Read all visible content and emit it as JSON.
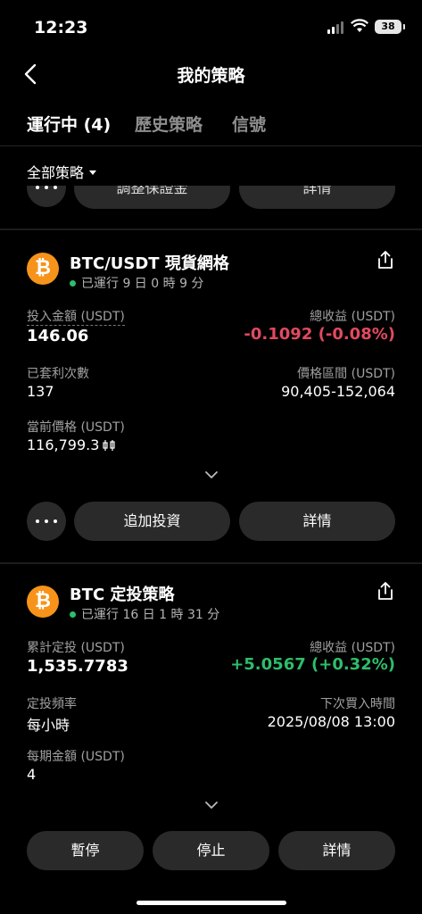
{
  "status": {
    "time": "12:23",
    "battery": "38"
  },
  "nav": {
    "title": "我的策略"
  },
  "tabs": [
    {
      "label": "運行中 (4)",
      "active": true
    },
    {
      "label": "歷史策略",
      "active": false
    },
    {
      "label": "信號",
      "active": false
    }
  ],
  "filter": {
    "label": "全部策略"
  },
  "prev_card": {
    "left_button": "調整保證金",
    "right_button": "詳情"
  },
  "grid_card": {
    "title": "BTC/USDT 現貨網格",
    "running": "已運行 9 日 0 時 9 分",
    "invest_label": "投入金額 (USDT)",
    "invest_value": "146.06",
    "profit_label": "總收益 (USDT)",
    "profit_value": "-0.1092 (-0.08%)",
    "arb_label": "已套利次數",
    "arb_value": "137",
    "range_label": "價格區間 (USDT)",
    "range_value": "90,405-152,064",
    "price_label": "當前價格 (USDT)",
    "price_value": "116,799.3",
    "btn_add": "追加投資",
    "btn_detail": "詳情"
  },
  "dca_card": {
    "title": "BTC 定投策略",
    "running": "已運行 16 日 1 時 31 分",
    "accum_label": "累計定投 (USDT)",
    "accum_value": "1,535.7783",
    "profit_label": "總收益 (USDT)",
    "profit_value": "+5.0567 (+0.32%)",
    "freq_label": "定投頻率",
    "freq_value": "每小時",
    "next_label": "下次買入時間",
    "next_value": "2025/08/08 13:00",
    "per_label": "每期金額 (USDT)",
    "per_value": "4",
    "btn_pause": "暫停",
    "btn_stop": "停止",
    "btn_detail": "詳情"
  },
  "colors": {
    "positive": "#2ebd6b",
    "negative": "#e04a5f",
    "btc": "#f7931a"
  }
}
